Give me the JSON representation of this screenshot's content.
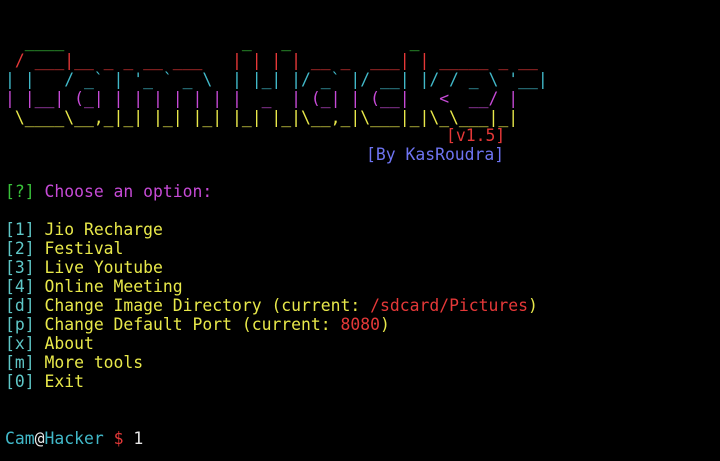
{
  "banner": {
    "lines": [
      {
        "text": "  ____                  _   _            _",
        "color": "#39c23a"
      },
      {
        "text": " / ___|__ _ _ __ ___   | | | | __ _  ___| | _____ _ __",
        "color": "#e53838"
      },
      {
        "text": "| |   / _` | '_ ` _ \\  | |_| |/ _` |/ __| |/ / _ \\ '__|",
        "color": "#41b8c8"
      },
      {
        "text": "| |__| (_| | | | | | | |  _  | (_| | (__|   <  __/ |",
        "color": "#c64ad6"
      },
      {
        "text": " \\____\\__,_|_| |_| |_| |_| |_|\\__,_|\\___|_|\\_\\___|_|",
        "color": "#e8e84a"
      }
    ],
    "version": "[v1.5]",
    "author": "[By KasRoudra]"
  },
  "prompt_question": {
    "marker": "[?]",
    "text": " Choose an option:"
  },
  "menu": [
    {
      "key": "[1]",
      "label": " Jio Recharge"
    },
    {
      "key": "[2]",
      "label": " Festival"
    },
    {
      "key": "[3]",
      "label": " Live Youtube"
    },
    {
      "key": "[4]",
      "label": " Online Meeting"
    },
    {
      "key": "[d]",
      "label": " Change Image Directory (current: ",
      "value": "/sdcard/Pictures",
      "suffix": ")"
    },
    {
      "key": "[p]",
      "label": " Change Default Port (current: ",
      "value": "8080",
      "suffix": ")"
    },
    {
      "key": "[x]",
      "label": " About"
    },
    {
      "key": "[m]",
      "label": " More tools"
    },
    {
      "key": "[0]",
      "label": " Exit"
    }
  ],
  "shell_prompt": {
    "user": "Cam",
    "at": "@",
    "host": "Hacker",
    "symbol": " $ ",
    "input": "1"
  }
}
